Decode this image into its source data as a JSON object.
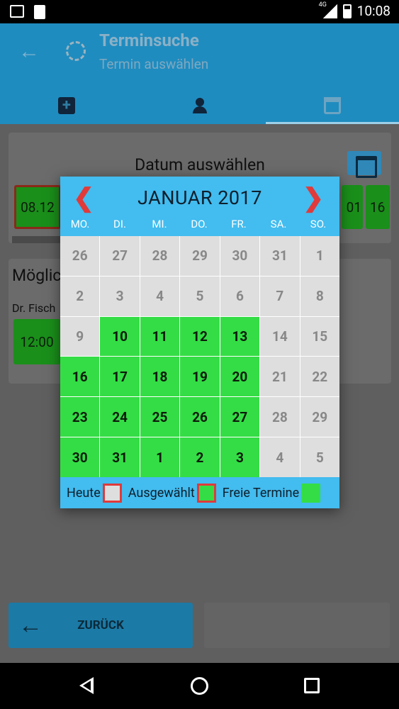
{
  "status": {
    "network": "4G",
    "time": "10:08"
  },
  "header": {
    "title": "Terminsuche",
    "subtitle": "Termin auswählen"
  },
  "page": {
    "card_title": "Datum auswählen",
    "selected_date": "08.12",
    "visible_dates": [
      "01",
      "16"
    ],
    "section_title": "Möglic",
    "doctor": "Dr. Fisch",
    "time_slot": "12:00",
    "back_button": "ZURÜCK"
  },
  "dialog": {
    "month_label": "JANUAR 2017",
    "weekdays": [
      "MO.",
      "DI.",
      "MI.",
      "DO.",
      "FR.",
      "SA.",
      "SO."
    ],
    "days": [
      {
        "d": "26",
        "free": false
      },
      {
        "d": "27",
        "free": false
      },
      {
        "d": "28",
        "free": false
      },
      {
        "d": "29",
        "free": false
      },
      {
        "d": "30",
        "free": false
      },
      {
        "d": "31",
        "free": false
      },
      {
        "d": "1",
        "free": false
      },
      {
        "d": "2",
        "free": false
      },
      {
        "d": "3",
        "free": false
      },
      {
        "d": "4",
        "free": false
      },
      {
        "d": "5",
        "free": false
      },
      {
        "d": "6",
        "free": false
      },
      {
        "d": "7",
        "free": false
      },
      {
        "d": "8",
        "free": false
      },
      {
        "d": "9",
        "free": false
      },
      {
        "d": "10",
        "free": true
      },
      {
        "d": "11",
        "free": true
      },
      {
        "d": "12",
        "free": true
      },
      {
        "d": "13",
        "free": true
      },
      {
        "d": "14",
        "free": false
      },
      {
        "d": "15",
        "free": false
      },
      {
        "d": "16",
        "free": true
      },
      {
        "d": "17",
        "free": true
      },
      {
        "d": "18",
        "free": true
      },
      {
        "d": "19",
        "free": true
      },
      {
        "d": "20",
        "free": true
      },
      {
        "d": "21",
        "free": false
      },
      {
        "d": "22",
        "free": false
      },
      {
        "d": "23",
        "free": true
      },
      {
        "d": "24",
        "free": true
      },
      {
        "d": "25",
        "free": true
      },
      {
        "d": "26",
        "free": true
      },
      {
        "d": "27",
        "free": true
      },
      {
        "d": "28",
        "free": false
      },
      {
        "d": "29",
        "free": false
      },
      {
        "d": "30",
        "free": true
      },
      {
        "d": "31",
        "free": true
      },
      {
        "d": "1",
        "free": true
      },
      {
        "d": "2",
        "free": true
      },
      {
        "d": "3",
        "free": true
      },
      {
        "d": "4",
        "free": false
      },
      {
        "d": "5",
        "free": false
      }
    ],
    "legend": {
      "today": "Heute",
      "selected": "Ausgewählt",
      "free": "Freie Termine"
    }
  },
  "colors": {
    "accent": "#43bcef",
    "free": "#34dd45",
    "marker": "#e03a3a",
    "appbar": "#1f8cbf"
  }
}
